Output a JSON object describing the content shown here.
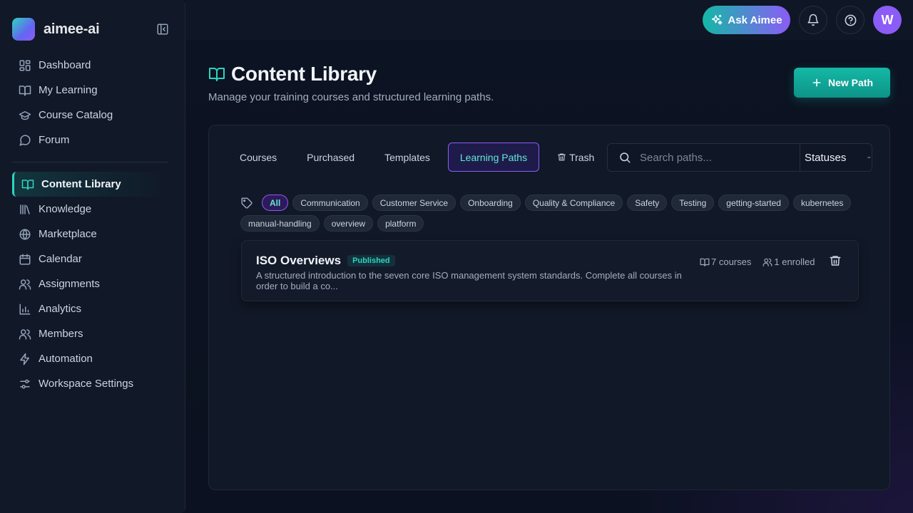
{
  "brand": {
    "name": "aimee-ai"
  },
  "sidebar": {
    "items": [
      {
        "label": "Dashboard"
      },
      {
        "label": "My Learning"
      },
      {
        "label": "Course Catalog"
      },
      {
        "label": "Forum"
      },
      {
        "label": "Content Library"
      },
      {
        "label": "Knowledge"
      },
      {
        "label": "Marketplace"
      },
      {
        "label": "Calendar"
      },
      {
        "label": "Assignments"
      },
      {
        "label": "Analytics"
      },
      {
        "label": "Members"
      },
      {
        "label": "Automation"
      },
      {
        "label": "Workspace Settings"
      }
    ],
    "active": "Content Library"
  },
  "topbar": {
    "ask_label": "Ask Aimee",
    "avatar_initial": "W"
  },
  "page": {
    "title": "Content Library",
    "subtitle": "Manage your training courses and structured learning paths.",
    "new_button": "New Path"
  },
  "tabs": [
    {
      "label": "Courses"
    },
    {
      "label": "Purchased"
    },
    {
      "label": "Templates"
    },
    {
      "label": "Learning Paths"
    },
    {
      "label": "Trash"
    }
  ],
  "search": {
    "placeholder": "Search paths...",
    "status_label": "Statuses"
  },
  "tags": [
    "All",
    "Communication",
    "Customer Service",
    "Onboarding",
    "Quality & Compliance",
    "Safety",
    "Testing",
    "getting-started",
    "kubernetes",
    "manual-handling",
    "overview",
    "platform"
  ],
  "paths": [
    {
      "title": "ISO Overviews",
      "status": "Published",
      "description": "A structured introduction to the seven core ISO management system standards. Complete all courses in order to build a co...",
      "courses": "7 courses",
      "enrolled": "1 enrolled"
    }
  ],
  "colors": {
    "accent": "#14b8a6",
    "brand_purple": "#8b5cf6",
    "background": "#0b1120"
  }
}
